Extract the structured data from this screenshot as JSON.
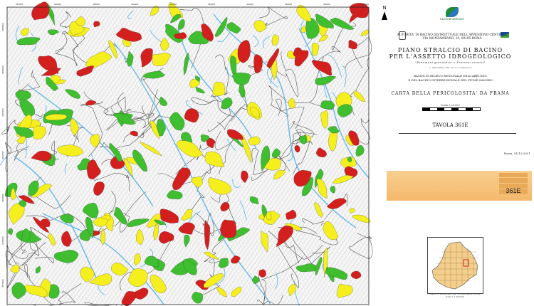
{
  "map": {
    "grid_labels_top": [
      "434000",
      "436000",
      "438000",
      "440000",
      "442000",
      "444000",
      "446000",
      "448000",
      "450000",
      "452000"
    ],
    "grid_labels_left": [
      "4688000",
      "4686000",
      "4684000",
      "4682000",
      "4680000",
      "4678000",
      "4676000"
    ],
    "colors": {
      "red": "#d41f1f",
      "yellow": "#f5ef1e",
      "green": "#3fbf2f",
      "river": "#67b8e8",
      "line": "#444444"
    }
  },
  "sheet": {
    "north_label": "N",
    "region_logo_text": "REGIONE ABRUZZO",
    "authority": "AUTORITA' DI BACINO DISTRETTUALE DELL'APPENNINO CENTRALE",
    "authority_sub": "VIA MONZAMBANO, 10, 00185 ROMA",
    "title_line1": "PIANO STRALCIO DI BACINO",
    "title_line2": "PER L'ASSETTO IDROGEOLOGICO",
    "subtitle": "\"Fenomeni gravitativi e Processi erosivi\"",
    "legal_note": "L. 18/5/1989 n.183, art.17 comma 6 ter",
    "basin_line1": "BACINI DI RILIEVO REGIONALE DELL'ABRUZZO",
    "basin_line2": "E DEL BACINO INTERREGIONALE DEL FIUME SANGRO",
    "map_title": "CARTA DELLA PERICOLOSITA' DA FRANA",
    "scale": "Scala 1:25.000",
    "tavola": "TAVOLA 361E",
    "date": "Roma, 01/12/2021",
    "sheet_code": "361E",
    "inset_caption_1": "Quadro di unione dei Fogli 1:25.000 (serie 25/IGM)",
    "inset_caption_2": "Scala 1:1.000.000"
  }
}
